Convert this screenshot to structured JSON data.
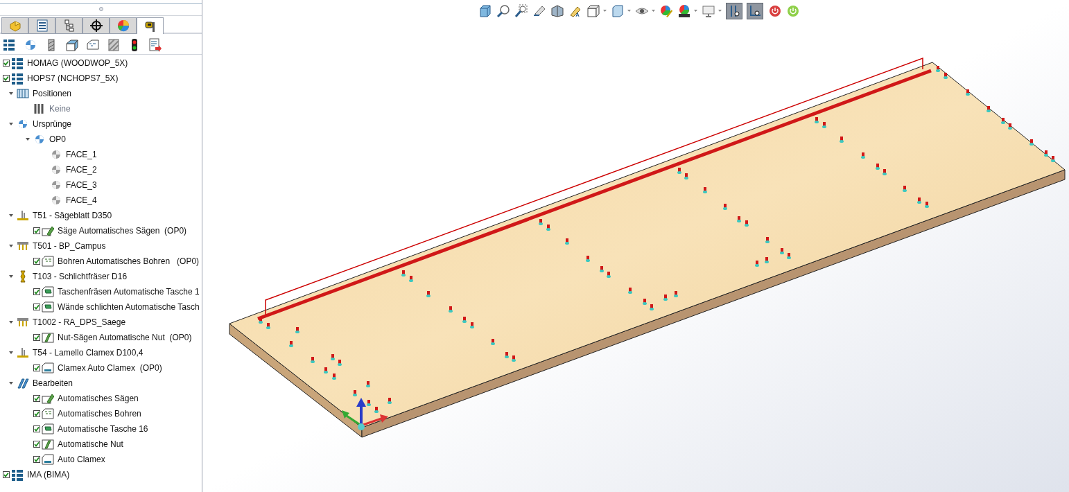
{
  "panel_tabs": [
    {
      "selected": false
    },
    {
      "selected": false
    },
    {
      "selected": false
    },
    {
      "selected": false
    },
    {
      "selected": false
    },
    {
      "selected": true
    }
  ],
  "tree": [
    {
      "label": "HOMAG (WOODWOP_5X)",
      "kind": "nc",
      "checked": true
    },
    {
      "label": "HOPS7 (NCHOPS7_5X)",
      "kind": "nc",
      "checked": true,
      "children": [
        {
          "label": "Positionen",
          "kind": "positions",
          "expanded": true,
          "children": [
            {
              "label": "Keine",
              "kind": "bars",
              "disabled": true
            }
          ]
        },
        {
          "label": "Ursprünge",
          "kind": "origin",
          "expanded": true,
          "children": [
            {
              "label": "OP0",
              "kind": "origin",
              "expanded": true,
              "children": [
                {
                  "label": "FACE_1",
                  "kind": "face"
                },
                {
                  "label": "FACE_2",
                  "kind": "face"
                },
                {
                  "label": "FACE_3",
                  "kind": "face"
                },
                {
                  "label": "FACE_4",
                  "kind": "face"
                }
              ]
            }
          ]
        },
        {
          "label": "T51 - Sägeblatt D350",
          "kind": "blade",
          "expanded": true,
          "children": [
            {
              "label": "Säge Automatisches Sägen  (OP0)",
              "kind": "saw",
              "checked": true
            }
          ]
        },
        {
          "label": "T501 - BP_Campus",
          "kind": "drill-head",
          "expanded": true,
          "children": [
            {
              "label": "Bohren Automatisches Bohren   (OP0)",
              "kind": "drill",
              "checked": true
            }
          ]
        },
        {
          "label": "T103 - Schlichtfräser D16",
          "kind": "mill",
          "expanded": true,
          "children": [
            {
              "label": "Taschenfräsen Automatische Tasche 1",
              "kind": "pocket",
              "checked": true
            },
            {
              "label": "Wände schlichten Automatische Tasch",
              "kind": "pocket",
              "checked": true
            }
          ]
        },
        {
          "label": "T1002 - RA_DPS_Saege",
          "kind": "drill-head",
          "expanded": true,
          "children": [
            {
              "label": "Nut-Sägen Automatische Nut  (OP0)",
              "kind": "groove",
              "checked": true
            }
          ]
        },
        {
          "label": "T54 - Lamello Clamex D100,4",
          "kind": "blade",
          "expanded": true,
          "children": [
            {
              "label": "Clamex Auto Clamex  (OP0)",
              "kind": "clamex",
              "checked": true
            }
          ]
        },
        {
          "label": "Bearbeiten",
          "kind": "features",
          "expanded": true,
          "children": [
            {
              "label": "Automatisches Sägen",
              "kind": "saw",
              "checked": true
            },
            {
              "label": "Automatisches Bohren",
              "kind": "drill",
              "checked": true
            },
            {
              "label": "Automatische Tasche 16",
              "kind": "pocket",
              "checked": true
            },
            {
              "label": "Automatische Nut",
              "kind": "groove",
              "checked": true
            },
            {
              "label": "Auto Clamex",
              "kind": "clamex",
              "checked": true
            }
          ]
        }
      ]
    },
    {
      "label": "IMA (BIMA)",
      "kind": "nc",
      "checked": true
    }
  ],
  "view_toggles": [
    {
      "pressed": true
    },
    {
      "pressed": true
    }
  ]
}
